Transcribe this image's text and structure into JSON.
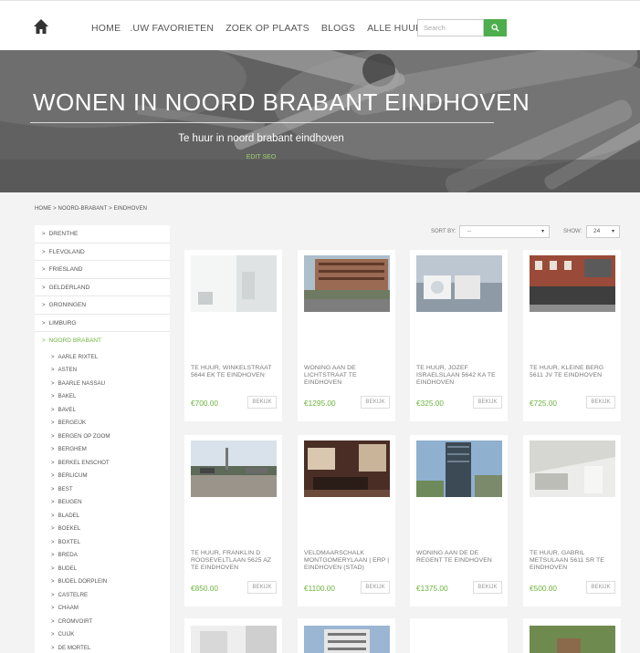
{
  "nav": {
    "items": [
      "HOME",
      ".UW FAVORIETEN",
      "ZOEK OP PLAATS",
      "BLOGS",
      "ALLE HUURWONINGEN"
    ],
    "search_placeholder": "Search"
  },
  "hero": {
    "title": "WONEN IN NOORD BRABANT EINDHOVEN",
    "subtitle": "Te huur in noord brabant eindhoven",
    "edit_link": "EDIT SEO"
  },
  "breadcrumb": "HOME  >  NOORD-BRABANT  >  EINDHOVEN",
  "sidebar": {
    "provinces_before": [
      "DRENTHE",
      "FLEVOLAND",
      "FRIESLAND",
      "GELDERLAND",
      "GRONINGEN",
      "LIMBURG"
    ],
    "active_province": "NOORD BRABANT",
    "cities": [
      "AARLE RIXTEL",
      "ASTEN",
      "BAARLE NASSAU",
      "BAKEL",
      "BAVEL",
      "BERGEIJK",
      "BERGEN OP ZOOM",
      "BERGHEM",
      "BERKEL ENSCHOT",
      "BERLICUM",
      "BEST",
      "BEUGEN",
      "BLADEL",
      "BOEKEL",
      "BOXTEL",
      "BREDA",
      "BUDEL",
      "BUDEL DORPLEIN",
      "CASTELRE",
      "CHAAM",
      "CROMVOIRT",
      "CUIJK",
      "DE MORTEL"
    ]
  },
  "sort": {
    "label": "SORT BY:",
    "value": "--"
  },
  "show": {
    "label": "SHOW:",
    "value": "24"
  },
  "listings": [
    {
      "title": "TE HUUR, WINKELSTRAAT 5644 EK TE EINDHOVEN",
      "price": "€700.00",
      "button": "BEKIJK"
    },
    {
      "title": "WONING AAN DE LICHTSTRAAT TE EINDHOVEN",
      "price": "€1295.00",
      "button": "BEKIJK"
    },
    {
      "title": "TE HUUR, JOZEF ISRAELSLAAN 5642 KA TE EINDHOVEN",
      "price": "€325.00",
      "button": "BEKIJK"
    },
    {
      "title": "TE HUUR, KLEINE BERG 5611 JV TE EINDHOVEN",
      "price": "€725.00",
      "button": "BEKIJK"
    },
    {
      "title": "TE HUUR, FRANKLIN D ROOSEVELTLAAN 5625 AZ TE EINDHOVEN",
      "price": "€850.00",
      "button": "BEKIJK"
    },
    {
      "title": "VELDMAARSCHALK MONTGOMERYLAAN | ERP | EINDHOVEN (STAD)",
      "price": "€1100.00",
      "button": "BEKIJK"
    },
    {
      "title": "WONING AAN DE DE REGENT TE EINDHOVEN",
      "price": "€1375.00",
      "button": "BEKIJK"
    },
    {
      "title": "TE HUUR, GABRIL METSULAAN 5611 SR TE EINDHOVEN",
      "price": "€500.00",
      "button": "BEKIJK"
    }
  ]
}
